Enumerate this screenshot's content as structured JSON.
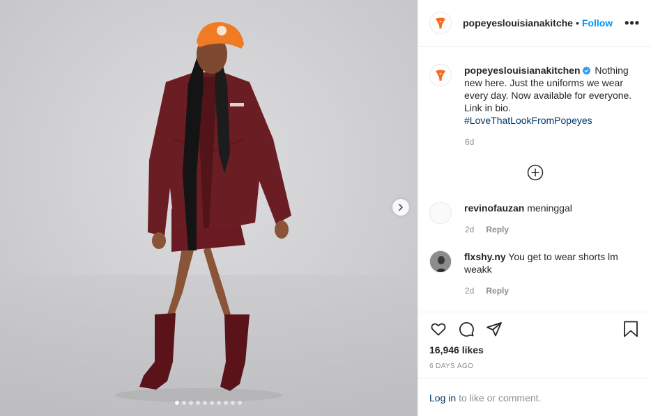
{
  "post": {
    "username_header": "popeyeslouisianakitche",
    "separator": "•",
    "follow_label": "Follow",
    "more_label": "•••",
    "caption": {
      "username": "popeyeslouisianakitchen",
      "text": "Nothing new here. Just the uniforms we wear every day. Now available for everyone. Link in bio.",
      "hashtag": "#LoveThatLookFromPopeyes",
      "age": "6d"
    },
    "comments": [
      {
        "username": "revinofauzan",
        "text": "meninggal",
        "age": "2d",
        "reply_label": "Reply"
      },
      {
        "username": "flxshy.ny",
        "text": "You get to wear shorts lm weakk",
        "age": "2d",
        "reply_label": "Reply"
      }
    ],
    "likes": "16,946 likes",
    "date": "6 DAYS AGO",
    "login_label": "Log in",
    "login_suffix": "to like or comment.",
    "carousel": {
      "slides": 10,
      "active_index": 0
    }
  },
  "icons": {
    "avatar": "popeyes-logo-icon",
    "verified": "verified-badge-icon",
    "add": "plus-circle-icon",
    "like": "heart-icon",
    "comment": "comment-bubble-icon",
    "share": "paper-plane-icon",
    "save": "bookmark-icon",
    "next": "chevron-right-icon"
  },
  "colors": {
    "brand_orange": "#f26b21",
    "link_blue": "#0095f6",
    "hashtag_navy": "#00376b",
    "meta_gray": "#8e8e8e",
    "jacket_burgundy": "#6b1d24"
  }
}
